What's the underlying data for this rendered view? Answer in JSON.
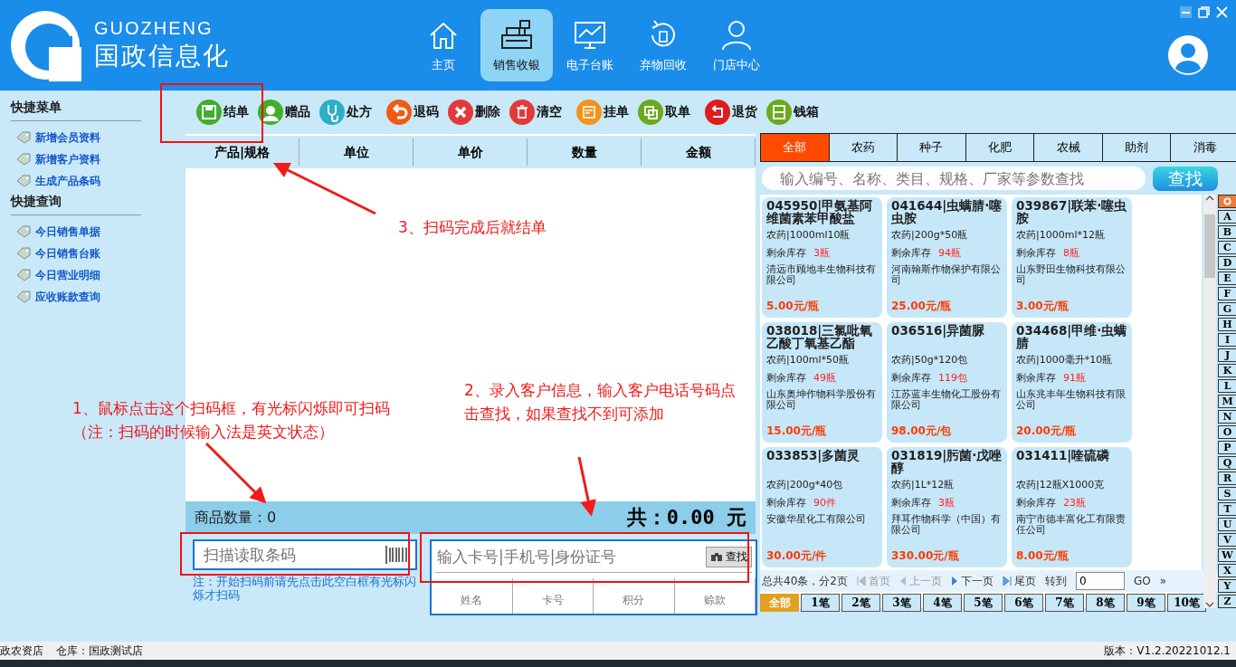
{
  "brand": {
    "latin": "GUOZHENG",
    "name": "国政信息化"
  },
  "nav": [
    {
      "label": "主页",
      "selected": false
    },
    {
      "label": "销售收银",
      "selected": true
    },
    {
      "label": "电子台账",
      "selected": false
    },
    {
      "label": "弃物回收",
      "selected": false
    },
    {
      "label": "门店中心",
      "selected": false
    }
  ],
  "sidebar": [
    {
      "title": "快捷菜单",
      "items": [
        "新增会员资料",
        "新增客户资料",
        "生成产品条码"
      ]
    },
    {
      "title": "快捷查询",
      "items": [
        "今日销售单据",
        "今日销售台账",
        "今日营业明细",
        "应收账款查询"
      ]
    }
  ],
  "toolbar": [
    {
      "label": "结单"
    },
    {
      "label": "赠品"
    },
    {
      "label": "处方"
    },
    {
      "label": "退码"
    },
    {
      "label": "删除"
    },
    {
      "label": "清空"
    },
    {
      "label": "挂单"
    },
    {
      "label": "取单"
    },
    {
      "label": "退货"
    },
    {
      "label": "钱箱"
    }
  ],
  "order_table": {
    "columns": [
      "产品|规格",
      "单位",
      "单价",
      "数量",
      "金额"
    ]
  },
  "summary": {
    "count": "商品数量：0",
    "total": "共：0.00 元"
  },
  "barcode_field": {
    "placeholder": "扫描读取条码"
  },
  "scan_note": "注：开始扫码前请先点击此空白框有光标闪烁才扫码",
  "member": {
    "placeholder": "输入卡号|手机号|身份证号",
    "button": "查找",
    "columns": [
      "姓名",
      "卡号",
      "积分",
      "赊款"
    ]
  },
  "categories": [
    {
      "label": "全部",
      "selected": true
    },
    {
      "label": "农药",
      "selected": false
    },
    {
      "label": "种子",
      "selected": false
    },
    {
      "label": "化肥",
      "selected": false
    },
    {
      "label": "农械",
      "selected": false
    },
    {
      "label": "助剂",
      "selected": false
    },
    {
      "label": "消毒",
      "selected": false
    }
  ],
  "product_search": {
    "placeholder": "输入编号、名称、类目、规格、厂家等参数查找",
    "button": "查找"
  },
  "products": [
    {
      "title": "045950|甲氨基阿维菌素苯甲酸盐",
      "spec": "农药|1000ml10瓶",
      "stock_label": "剩余库存",
      "stock": "3瓶",
      "maker": "清远市顾地丰生物科技有限公司",
      "price": "5.00元/瓶"
    },
    {
      "title": "041644|虫螨腈·噻虫胺",
      "spec": "农药|200g*50瓶",
      "stock_label": "剩余库存",
      "stock": "94瓶",
      "maker": "河南翰斯作物保护有限公司",
      "price": "25.00元/瓶"
    },
    {
      "title": "039867|联苯·噻虫胺",
      "spec": "农药|1000ml*12瓶",
      "stock_label": "剩余库存",
      "stock": "8瓶",
      "maker": "山东野田生物科技有限公司",
      "price": "3.00元/瓶"
    },
    {
      "title": "038018|三氯吡氧乙酸丁氧基乙酯",
      "spec": "农药|100ml*50瓶",
      "stock_label": "剩余库存",
      "stock": "49瓶",
      "maker": "山东奥坤作物科学股份有限公司",
      "price": "15.00元/瓶"
    },
    {
      "title": "036516|异菌脲",
      "spec": "农药|50g*120包",
      "stock_label": "剩余库存",
      "stock": "119包",
      "maker": "江苏蓝丰生物化工股份有限公司",
      "price": "98.00元/包"
    },
    {
      "title": "034468|甲维·虫螨腈",
      "spec": "农药|1000毫升*10瓶",
      "stock_label": "剩余库存",
      "stock": "91瓶",
      "maker": "山东兆丰年生物科技有限公司",
      "price": "20.00元/瓶"
    },
    {
      "title": "033853|多菌灵",
      "spec": "农药|200g*40包",
      "stock_label": "剩余库存",
      "stock": "90件",
      "maker": "安徽华星化工有限公司",
      "price": "30.00元/件"
    },
    {
      "title": "031819|肟菌·戊唑醇",
      "spec": "农药|1L*12瓶",
      "stock_label": "剩余库存",
      "stock": "3瓶",
      "maker": "拜耳作物科学（中国）有限公司",
      "price": "330.00元/瓶"
    },
    {
      "title": "031411|喹硫磷",
      "spec": "农药|12瓶X1000克",
      "stock_label": "剩余库存",
      "stock": "23瓶",
      "maker": "南宁市德丰富化工有限责任公司",
      "price": "8.00元/瓶"
    }
  ],
  "letter_index": [
    {
      "kind": "all",
      "selected": true
    },
    {
      "kind": "letter",
      "label": "A",
      "selected": false
    },
    {
      "kind": "letter",
      "label": "B",
      "selected": false
    },
    {
      "kind": "letter",
      "label": "C",
      "selected": false
    },
    {
      "kind": "letter",
      "label": "D",
      "selected": false
    },
    {
      "kind": "letter",
      "label": "E",
      "selected": false
    },
    {
      "kind": "letter",
      "label": "F",
      "selected": false
    },
    {
      "kind": "letter",
      "label": "G",
      "selected": false
    },
    {
      "kind": "letter",
      "label": "H",
      "selected": false
    },
    {
      "kind": "letter",
      "label": "I",
      "selected": false
    },
    {
      "kind": "letter",
      "label": "J",
      "selected": false
    },
    {
      "kind": "letter",
      "label": "K",
      "selected": false
    },
    {
      "kind": "letter",
      "label": "L",
      "selected": false
    },
    {
      "kind": "letter",
      "label": "M",
      "selected": false
    },
    {
      "kind": "letter",
      "label": "N",
      "selected": false
    },
    {
      "kind": "letter",
      "label": "O",
      "selected": false
    },
    {
      "kind": "letter",
      "label": "P",
      "selected": false
    },
    {
      "kind": "letter",
      "label": "Q",
      "selected": false
    },
    {
      "kind": "letter",
      "label": "R",
      "selected": false
    },
    {
      "kind": "letter",
      "label": "S",
      "selected": false
    },
    {
      "kind": "letter",
      "label": "T",
      "selected": false
    },
    {
      "kind": "letter",
      "label": "U",
      "selected": false
    },
    {
      "kind": "letter",
      "label": "V",
      "selected": false
    },
    {
      "kind": "letter",
      "label": "W",
      "selected": false
    },
    {
      "kind": "letter",
      "label": "X",
      "selected": false
    },
    {
      "kind": "letter",
      "label": "Y",
      "selected": false
    },
    {
      "kind": "letter",
      "label": "Z",
      "selected": false
    }
  ],
  "pagination": {
    "summary": "总共40条，分2页",
    "first": "首页",
    "prev": "上一页",
    "next": "下一页",
    "last": "尾页",
    "goto": "转到",
    "page": "0",
    "go": "GO",
    "more": "»"
  },
  "batch_tabs": [
    {
      "label": "全部",
      "selected": true
    },
    {
      "label": "1笔",
      "selected": false
    },
    {
      "label": "2笔",
      "selected": false
    },
    {
      "label": "3笔",
      "selected": false
    },
    {
      "label": "4笔",
      "selected": false
    },
    {
      "label": "5笔",
      "selected": false
    },
    {
      "label": "6笔",
      "selected": false
    },
    {
      "label": "7笔",
      "selected": false
    },
    {
      "label": "8笔",
      "selected": false
    },
    {
      "label": "9笔",
      "selected": false
    },
    {
      "label": "10笔",
      "selected": false
    }
  ],
  "status_bar": {
    "shop": "政农资店",
    "warehouse": "仓库：国政测试店",
    "version": "版本：V1.2.20221012.1"
  },
  "annotations": [
    {
      "text": "3、扫码完成后就结单"
    },
    {
      "text": "1、鼠标点击这个扫码框，有光标闪烁即可扫码（注：扫码的时候输入法是英文状态）"
    },
    {
      "text": "2、录入客户信息，输入客户电话号码点击查找，如果查找不到可添加"
    }
  ]
}
